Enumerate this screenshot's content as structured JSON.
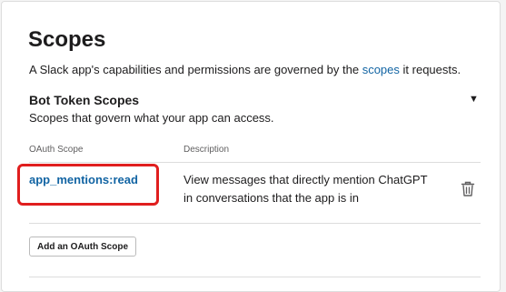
{
  "scopes": {
    "title": "Scopes",
    "subtitle_prefix": "A Slack app's capabilities and permissions are governed by the ",
    "subtitle_link": "scopes",
    "subtitle_suffix": " it requests.",
    "bot_token": {
      "title": "Bot Token Scopes",
      "subtitle": "Scopes that govern what your app can access.",
      "columns": {
        "scope": "OAuth Scope",
        "description": "Description"
      },
      "rows": [
        {
          "scope": "app_mentions:read",
          "description": "View messages that directly mention ChatGPT in conversations that the app is in"
        }
      ],
      "add_button": "Add an OAuth Scope"
    }
  },
  "icons": {
    "collapse": "caret-down-icon",
    "delete": "trash-icon"
  },
  "colors": {
    "link": "#1264a3",
    "highlight": "#e01e1e"
  }
}
